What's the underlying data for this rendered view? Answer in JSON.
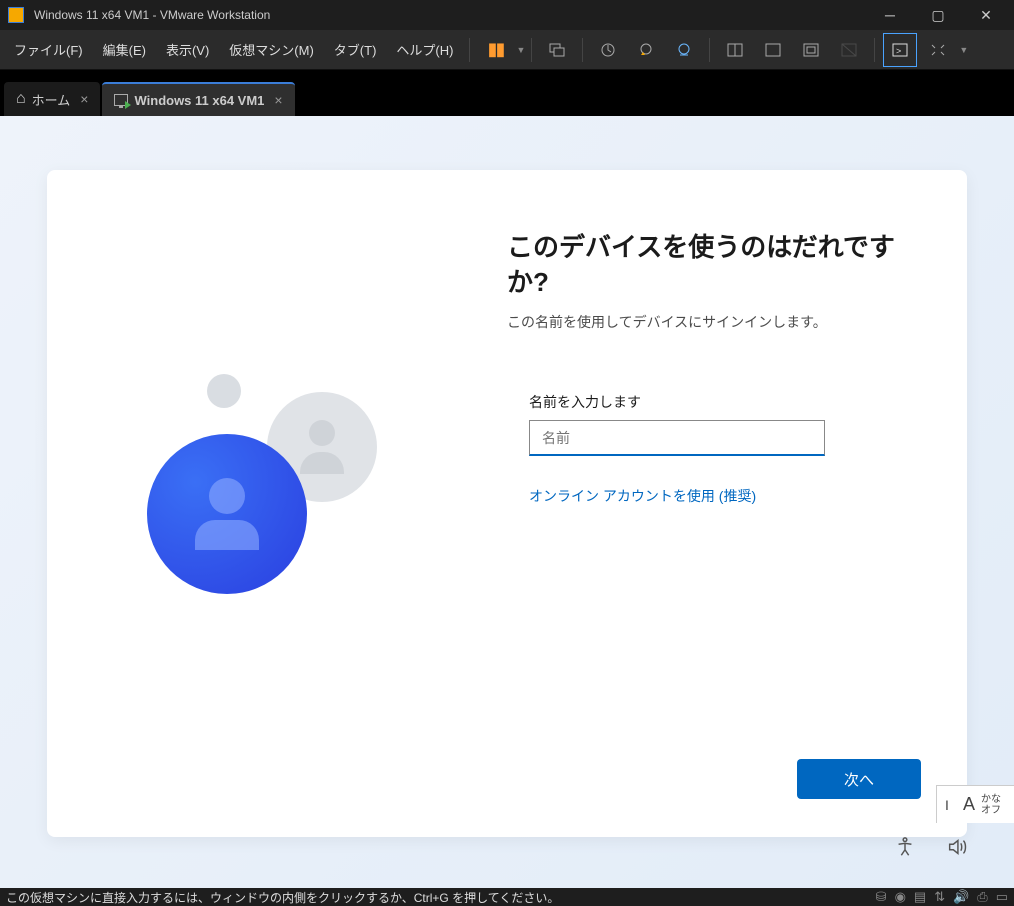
{
  "titlebar": {
    "title": "Windows 11 x64 VM1 - VMware Workstation"
  },
  "menu": {
    "file": "ファイル(F)",
    "edit": "編集(E)",
    "view": "表示(V)",
    "vm": "仮想マシン(M)",
    "tab": "タブ(T)",
    "help": "ヘルプ(H)"
  },
  "tabs": {
    "home": "ホーム",
    "vm1": "Windows 11 x64 VM1"
  },
  "oobe": {
    "title": "このデバイスを使うのはだれですか?",
    "subtitle": "この名前を使用してデバイスにサインインします。",
    "field_label": "名前を入力します",
    "placeholder": "名前",
    "online_link": "オンライン アカウントを使用 (推奨)",
    "next": "次へ"
  },
  "ime": {
    "mode_letter": "A",
    "kana": "かな",
    "off": "オフ"
  },
  "statusbar": {
    "message": "この仮想マシンに直接入力するには、ウィンドウの内側をクリックするか、Ctrl+G を押してください。"
  }
}
